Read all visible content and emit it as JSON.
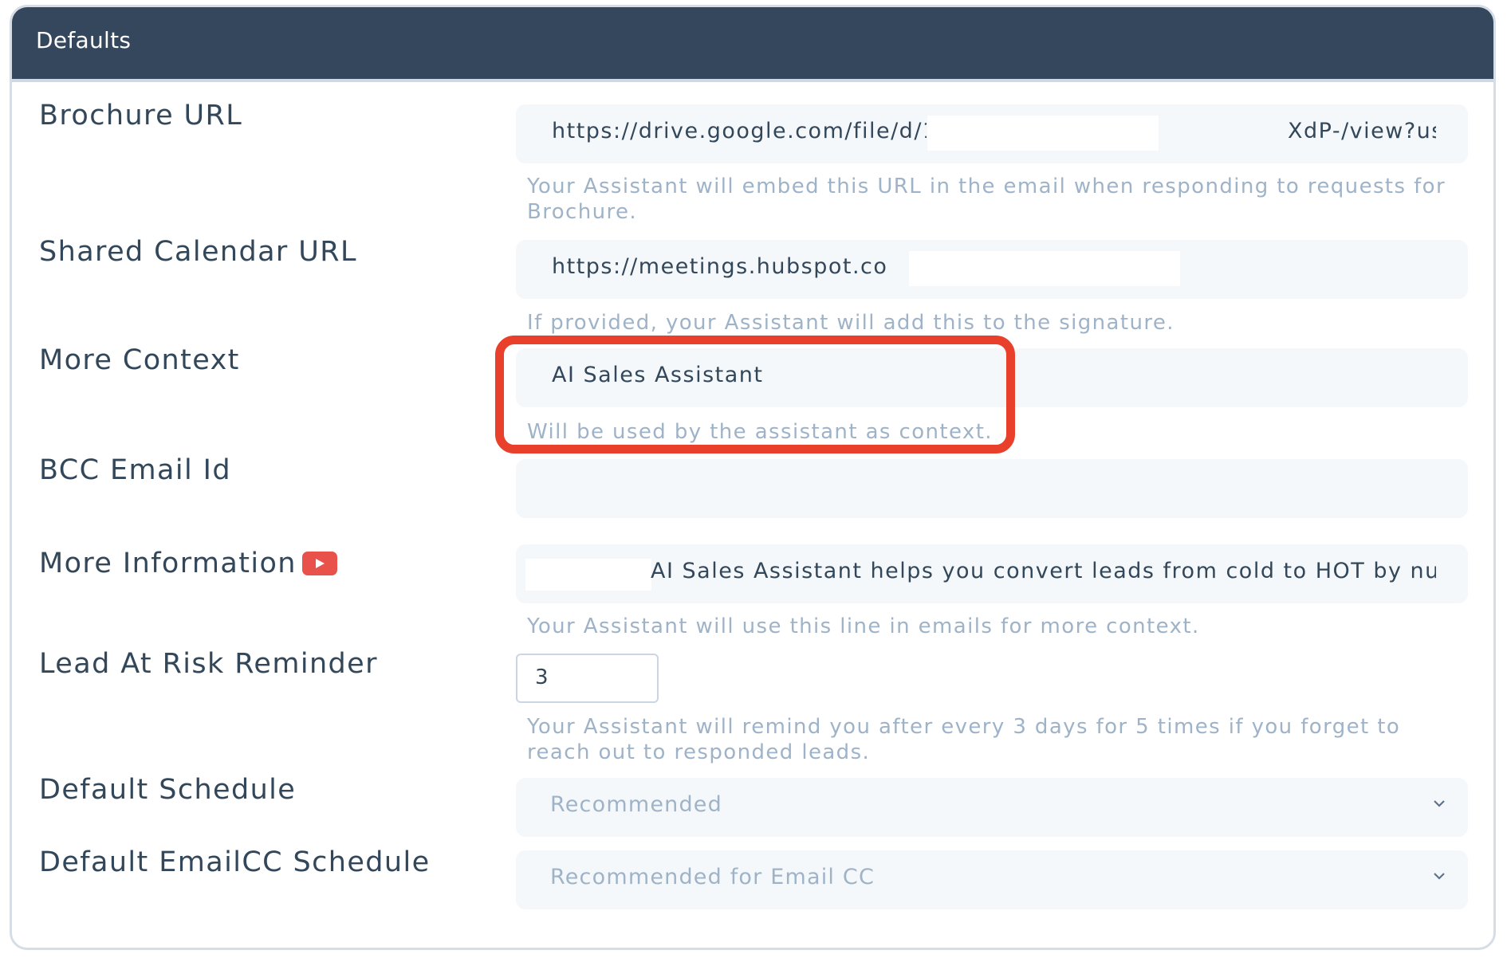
{
  "header": {
    "title": "Defaults"
  },
  "fields": {
    "brochure": {
      "label": "Brochure URL",
      "value_start": "https://drive.google.com/file/d/1xPALj3QW",
      "value_end": "XdP-/view?us",
      "hint": "Your Assistant will embed this URL in the email when responding to requests for Brochure."
    },
    "calendar": {
      "label": "Shared Calendar URL",
      "value": "https://meetings.hubspot.com/sa",
      "hint": "If provided, your Assistant will add this to the signature."
    },
    "context": {
      "label": "More Context",
      "value": "AI Sales Assistant",
      "hint": "Will be used by the assistant as context."
    },
    "bcc": {
      "label": "BCC Email Id",
      "value": ""
    },
    "info": {
      "label": "More Information",
      "value": "AI Sales Assistant helps you convert leads from cold to HOT by nurturing",
      "hint": "Your Assistant will use this line in emails for more context."
    },
    "reminder": {
      "label": "Lead At Risk Reminder",
      "value": "3",
      "hint": "Your Assistant will remind you after every 3 days for 5 times if you forget to reach out to responded leads."
    },
    "schedule": {
      "label": "Default Schedule",
      "value": "Recommended"
    },
    "emailcc_schedule": {
      "label": "Default EmailCC Schedule",
      "value": "Recommended for Email CC"
    }
  },
  "icons": {
    "info_video": "youtube-play-icon",
    "select_arrow": "chevron-down-icon"
  },
  "colors": {
    "header_bg": "#34475c",
    "label_text": "#33475b",
    "hint_text": "#9fb3c8",
    "field_bg": "#f5f8fa",
    "highlight": "#e8402a",
    "video_icon": "#e9524a"
  }
}
